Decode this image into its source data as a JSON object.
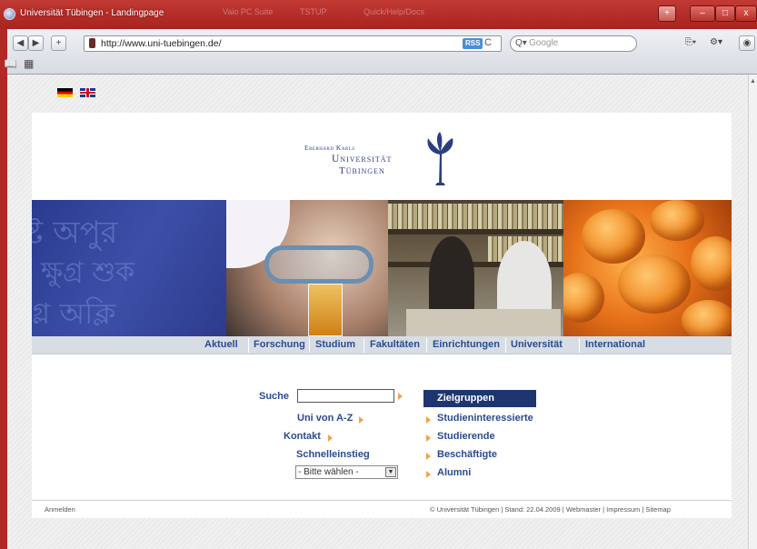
{
  "window": {
    "title": "Universität Tübingen - Landingpage",
    "faded_tabs": [
      "Vaio PC Suite",
      "TSTUP",
      "Quick/Help/Docs"
    ],
    "buttons": {
      "minimize": "–",
      "maximize": "□",
      "close": "x"
    }
  },
  "browser": {
    "url": "http://www.uni-tuebingen.de/",
    "rss_label": "RSS",
    "reload_glyph": "C",
    "search_placeholder": "Google",
    "back_glyph": "◀",
    "forward_glyph": "▶",
    "add_glyph": "+",
    "page_menu_glyph": "⎘▾",
    "settings_glyph": "⚙▾",
    "extra_glyph": "◉",
    "bookmarks_glyph": "📖",
    "topsites_glyph": "▦"
  },
  "page": {
    "languages": [
      "Deutsch",
      "English"
    ],
    "logo": {
      "line1": "Eberhard Karls",
      "line2": "Universität",
      "line3": "Tübingen"
    },
    "nav": [
      "Aktuell",
      "Forschung",
      "Studium",
      "Fakultäten",
      "Einrichtungen",
      "Universität",
      "International"
    ],
    "search": {
      "label": "Suche",
      "value": "",
      "placeholder": ""
    },
    "quick_links": [
      "Uni von A-Z",
      "Kontakt",
      "Schnelleinstieg"
    ],
    "select": {
      "value": "- Bitte wählen -"
    },
    "zielgruppen": {
      "header": "Zielgruppen",
      "items": [
        "Studieninteressierte",
        "Studierende",
        "Beschäftigte",
        "Alumni"
      ]
    },
    "footer": {
      "login": "Anmelden",
      "copyright": "© Universität Tübingen",
      "stand": "Stand: 22.04.2009",
      "links": [
        "Webmaster",
        "Impressum",
        "Sitemap"
      ]
    }
  },
  "colors": {
    "nav_text": "#2b4a8e",
    "zielgruppen_bg": "#1f3570",
    "accent_arrow": "#f4a24b",
    "window_frame": "#b32a2a"
  }
}
